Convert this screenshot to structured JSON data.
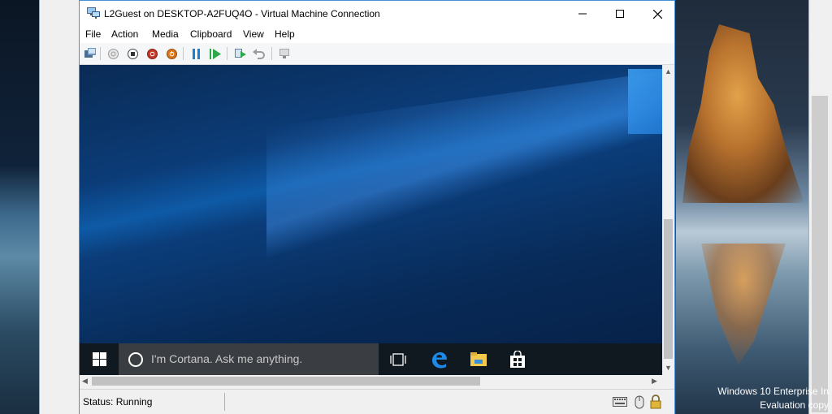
{
  "window": {
    "title": "L2Guest on DESKTOP-A2FUQ4O - Virtual Machine Connection",
    "controls": {
      "minimize": "—",
      "maximize": "☐",
      "close": "✕"
    }
  },
  "menu": [
    "File",
    "Action",
    "Media",
    "Clipboard",
    "View",
    "Help"
  ],
  "toolbar": {
    "buttons": [
      "ctrl-alt-del",
      "start",
      "turn-off",
      "shut-down",
      "save",
      "pause",
      "reset",
      "checkpoint",
      "revert",
      "enhanced-session"
    ]
  },
  "guest": {
    "taskbar": {
      "search_placeholder": "I'm Cortana. Ask me anything.",
      "icons": [
        "windows-start-icon",
        "task-view-icon",
        "edge-icon",
        "file-explorer-icon",
        "store-icon"
      ]
    }
  },
  "status": {
    "text": "Status: Running"
  },
  "host": {
    "watermark_line1": "Windows 10 Enterprise In",
    "watermark_line2": "Evaluation copy"
  },
  "colors": {
    "accent": "#4a90d9",
    "toolbar_green": "#2ea84a",
    "toolbar_blue": "#1a7fd4",
    "stop_red": "#c0392b",
    "shutdown_orange": "#d9731a"
  }
}
